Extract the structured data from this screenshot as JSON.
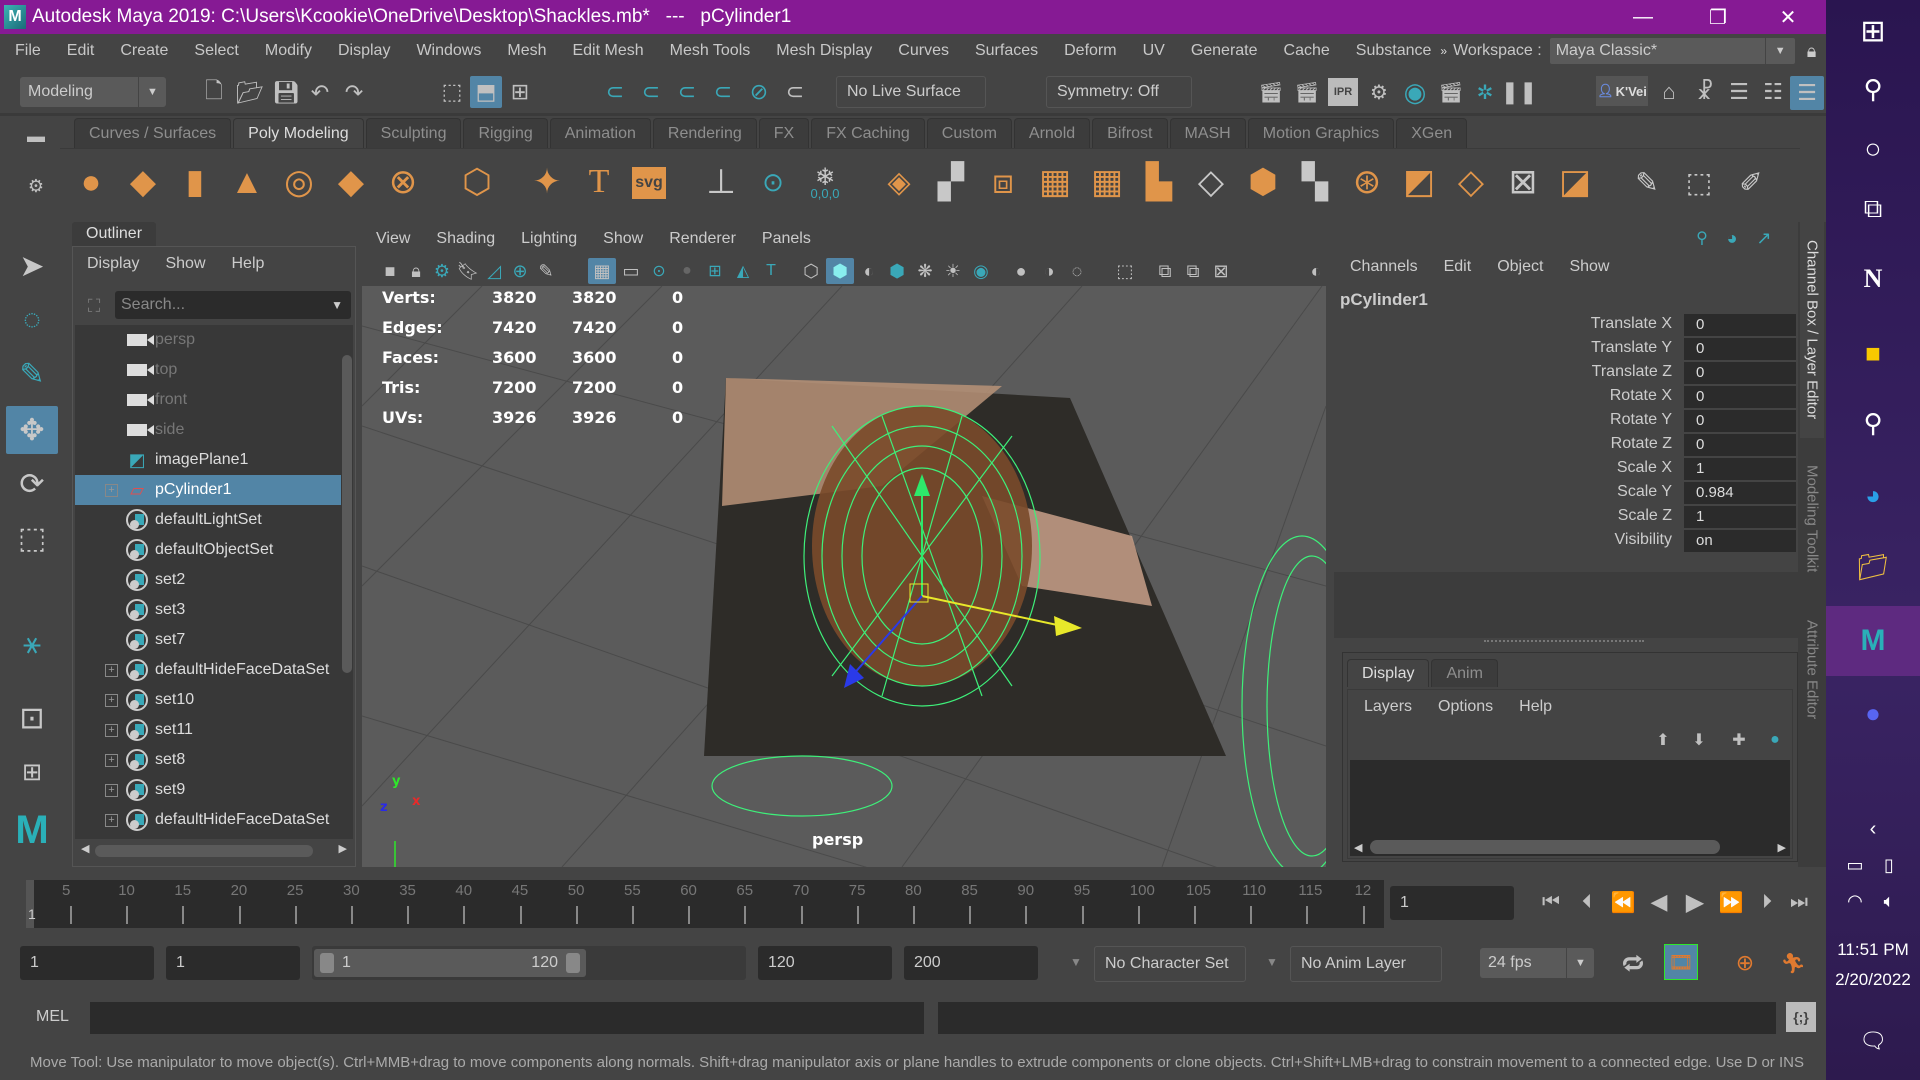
{
  "window": {
    "title": "Autodesk Maya 2019: C:\\Users\\Kcookie\\OneDrive\\Desktop\\Shackles.mb*   ---   pCylinder1",
    "controls": {
      "minimize": "—",
      "restore": "❐",
      "close": "✕"
    }
  },
  "menubar": {
    "items": [
      "File",
      "Edit",
      "Create",
      "Select",
      "Modify",
      "Display",
      "Windows",
      "Mesh",
      "Edit Mesh",
      "Mesh Tools",
      "Mesh Display",
      "Curves",
      "Surfaces",
      "Deform",
      "UV",
      "Generate",
      "Cache",
      "Substance"
    ],
    "more": "»",
    "workspace_label": "Workspace :",
    "workspace_value": "Maya Classic*"
  },
  "statusline": {
    "menuset": "Modeling",
    "live_surface": "No Live Surface",
    "symmetry": "Symmetry: Off",
    "user_label": "K'Vei"
  },
  "shelf": {
    "tabs": [
      "Curves / Surfaces",
      "Poly Modeling",
      "Sculpting",
      "Rigging",
      "Animation",
      "Rendering",
      "FX",
      "FX Caching",
      "Custom",
      "Arnold",
      "Bifrost",
      "MASH",
      "Motion Graphics",
      "XGen"
    ],
    "active_tab": "Poly Modeling",
    "svg_label": "svg",
    "text_label": "T",
    "origin_label": "0,0,0"
  },
  "outliner": {
    "tab": "Outliner",
    "menu": [
      "Display",
      "Show",
      "Help"
    ],
    "search_placeholder": "Search...",
    "items": [
      {
        "label": "persp",
        "type": "camera",
        "dim": true
      },
      {
        "label": "top",
        "type": "camera",
        "dim": true
      },
      {
        "label": "front",
        "type": "camera",
        "dim": true
      },
      {
        "label": "side",
        "type": "camera",
        "dim": true
      },
      {
        "label": "imagePlane1",
        "type": "imageplane"
      },
      {
        "label": "pCylinder1",
        "type": "mesh",
        "expandable": true,
        "selected": true
      },
      {
        "label": "defaultLightSet",
        "type": "set"
      },
      {
        "label": "defaultObjectSet",
        "type": "set"
      },
      {
        "label": "set2",
        "type": "set"
      },
      {
        "label": "set3",
        "type": "set"
      },
      {
        "label": "set7",
        "type": "set"
      },
      {
        "label": "defaultHideFaceDataSet",
        "type": "set",
        "expandable": true
      },
      {
        "label": "set10",
        "type": "set",
        "expandable": true
      },
      {
        "label": "set11",
        "type": "set",
        "expandable": true
      },
      {
        "label": "set8",
        "type": "set",
        "expandable": true
      },
      {
        "label": "set9",
        "type": "set",
        "expandable": true
      },
      {
        "label": "defaultHideFaceDataSet",
        "type": "set",
        "expandable": true
      }
    ]
  },
  "viewport": {
    "menu": [
      "View",
      "Shading",
      "Lighting",
      "Show",
      "Renderer",
      "Panels"
    ],
    "hud": [
      {
        "label": "Verts:",
        "a": "3820",
        "b": "3820",
        "c": "0"
      },
      {
        "label": "Edges:",
        "a": "7420",
        "b": "7420",
        "c": "0"
      },
      {
        "label": "Faces:",
        "a": "3600",
        "b": "3600",
        "c": "0"
      },
      {
        "label": "Tris:",
        "a": "7200",
        "b": "7200",
        "c": "0"
      },
      {
        "label": "UVs:",
        "a": "3926",
        "b": "3926",
        "c": "0"
      }
    ],
    "camera_label": "persp",
    "axis": {
      "x": "x",
      "y": "y",
      "z": "z"
    }
  },
  "channelbox": {
    "menu": [
      "Channels",
      "Edit",
      "Object",
      "Show"
    ],
    "object": "pCylinder1",
    "attributes": [
      {
        "name": "Translate X",
        "value": "0"
      },
      {
        "name": "Translate Y",
        "value": "0"
      },
      {
        "name": "Translate Z",
        "value": "0"
      },
      {
        "name": "Rotate X",
        "value": "0"
      },
      {
        "name": "Rotate Y",
        "value": "0"
      },
      {
        "name": "Rotate Z",
        "value": "0"
      },
      {
        "name": "Scale X",
        "value": "1"
      },
      {
        "name": "Scale Y",
        "value": "0.984"
      },
      {
        "name": "Scale Z",
        "value": "1"
      },
      {
        "name": "Visibility",
        "value": "on"
      }
    ],
    "layer_tabs": [
      "Display",
      "Anim"
    ],
    "layer_menu": [
      "Layers",
      "Options",
      "Help"
    ]
  },
  "side_tabs": [
    "Channel Box / Layer Editor",
    "Modeling Toolkit",
    "Attribute Editor"
  ],
  "timeline": {
    "ticks": [
      "5",
      "10",
      "15",
      "20",
      "25",
      "30",
      "35",
      "40",
      "45",
      "50",
      "55",
      "60",
      "65",
      "70",
      "75",
      "80",
      "85",
      "90",
      "95",
      "100",
      "105",
      "110",
      "115",
      "12"
    ],
    "current_marker": "1",
    "current_frame": "1"
  },
  "range": {
    "start": "1",
    "anim_start": "1",
    "slider_start": "1",
    "slider_end": "120",
    "anim_end": "120",
    "end": "200",
    "character_set": "No Character Set",
    "anim_layer": "No Anim Layer",
    "fps": "24 fps"
  },
  "cmdline": {
    "label": "MEL"
  },
  "helpline": {
    "text": "Move Tool: Use manipulator to move object(s). Ctrl+MMB+drag to move components along normals. Shift+drag manipulator axis or plane handles to extrude components or clone objects. Ctrl+Shift+LMB+drag to constrain movement to a connected edge. Use D or INS"
  },
  "taskbar": {
    "time": "11:51 PM",
    "date": "2/20/2022"
  }
}
